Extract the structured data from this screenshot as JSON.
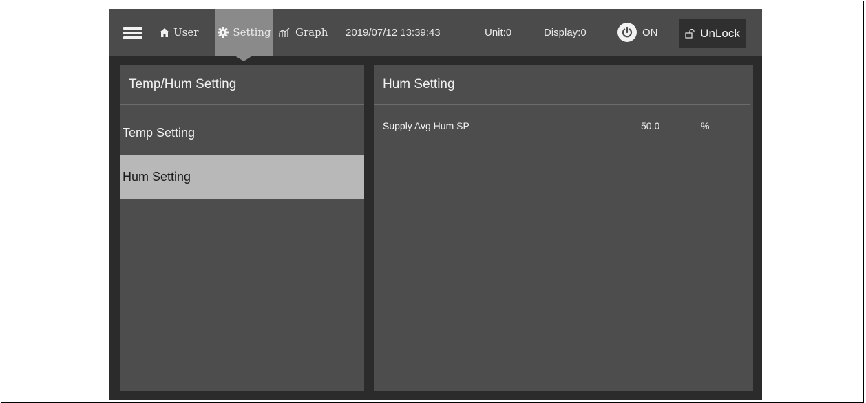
{
  "topbar": {
    "nav": {
      "user": "User",
      "setting": "Setting",
      "graph": "Graph"
    },
    "datetime": "2019/07/12 13:39:43",
    "unit": "Unit:0",
    "display": "Display:0",
    "power_label": "ON",
    "lock_label": "UnLock",
    "icons": [
      "menu-icon",
      "home-icon",
      "gear-icon",
      "graph-icon",
      "power-icon",
      "unlock-icon"
    ]
  },
  "left_panel": {
    "title": "Temp/Hum Setting",
    "items": [
      {
        "label": "Temp Setting",
        "selected": false
      },
      {
        "label": "Hum Setting",
        "selected": true
      }
    ]
  },
  "right_panel": {
    "title": "Hum Setting",
    "rows": [
      {
        "label": "Supply Avg Hum SP",
        "value": "50.0",
        "unit": "%"
      }
    ]
  },
  "colors": {
    "topbar": "#4b4b4b",
    "nav_active": "#8a8a8a",
    "panel": "#4c4d4c",
    "selected_item": "#b8b8b8",
    "frame": "#2b2b2b"
  }
}
